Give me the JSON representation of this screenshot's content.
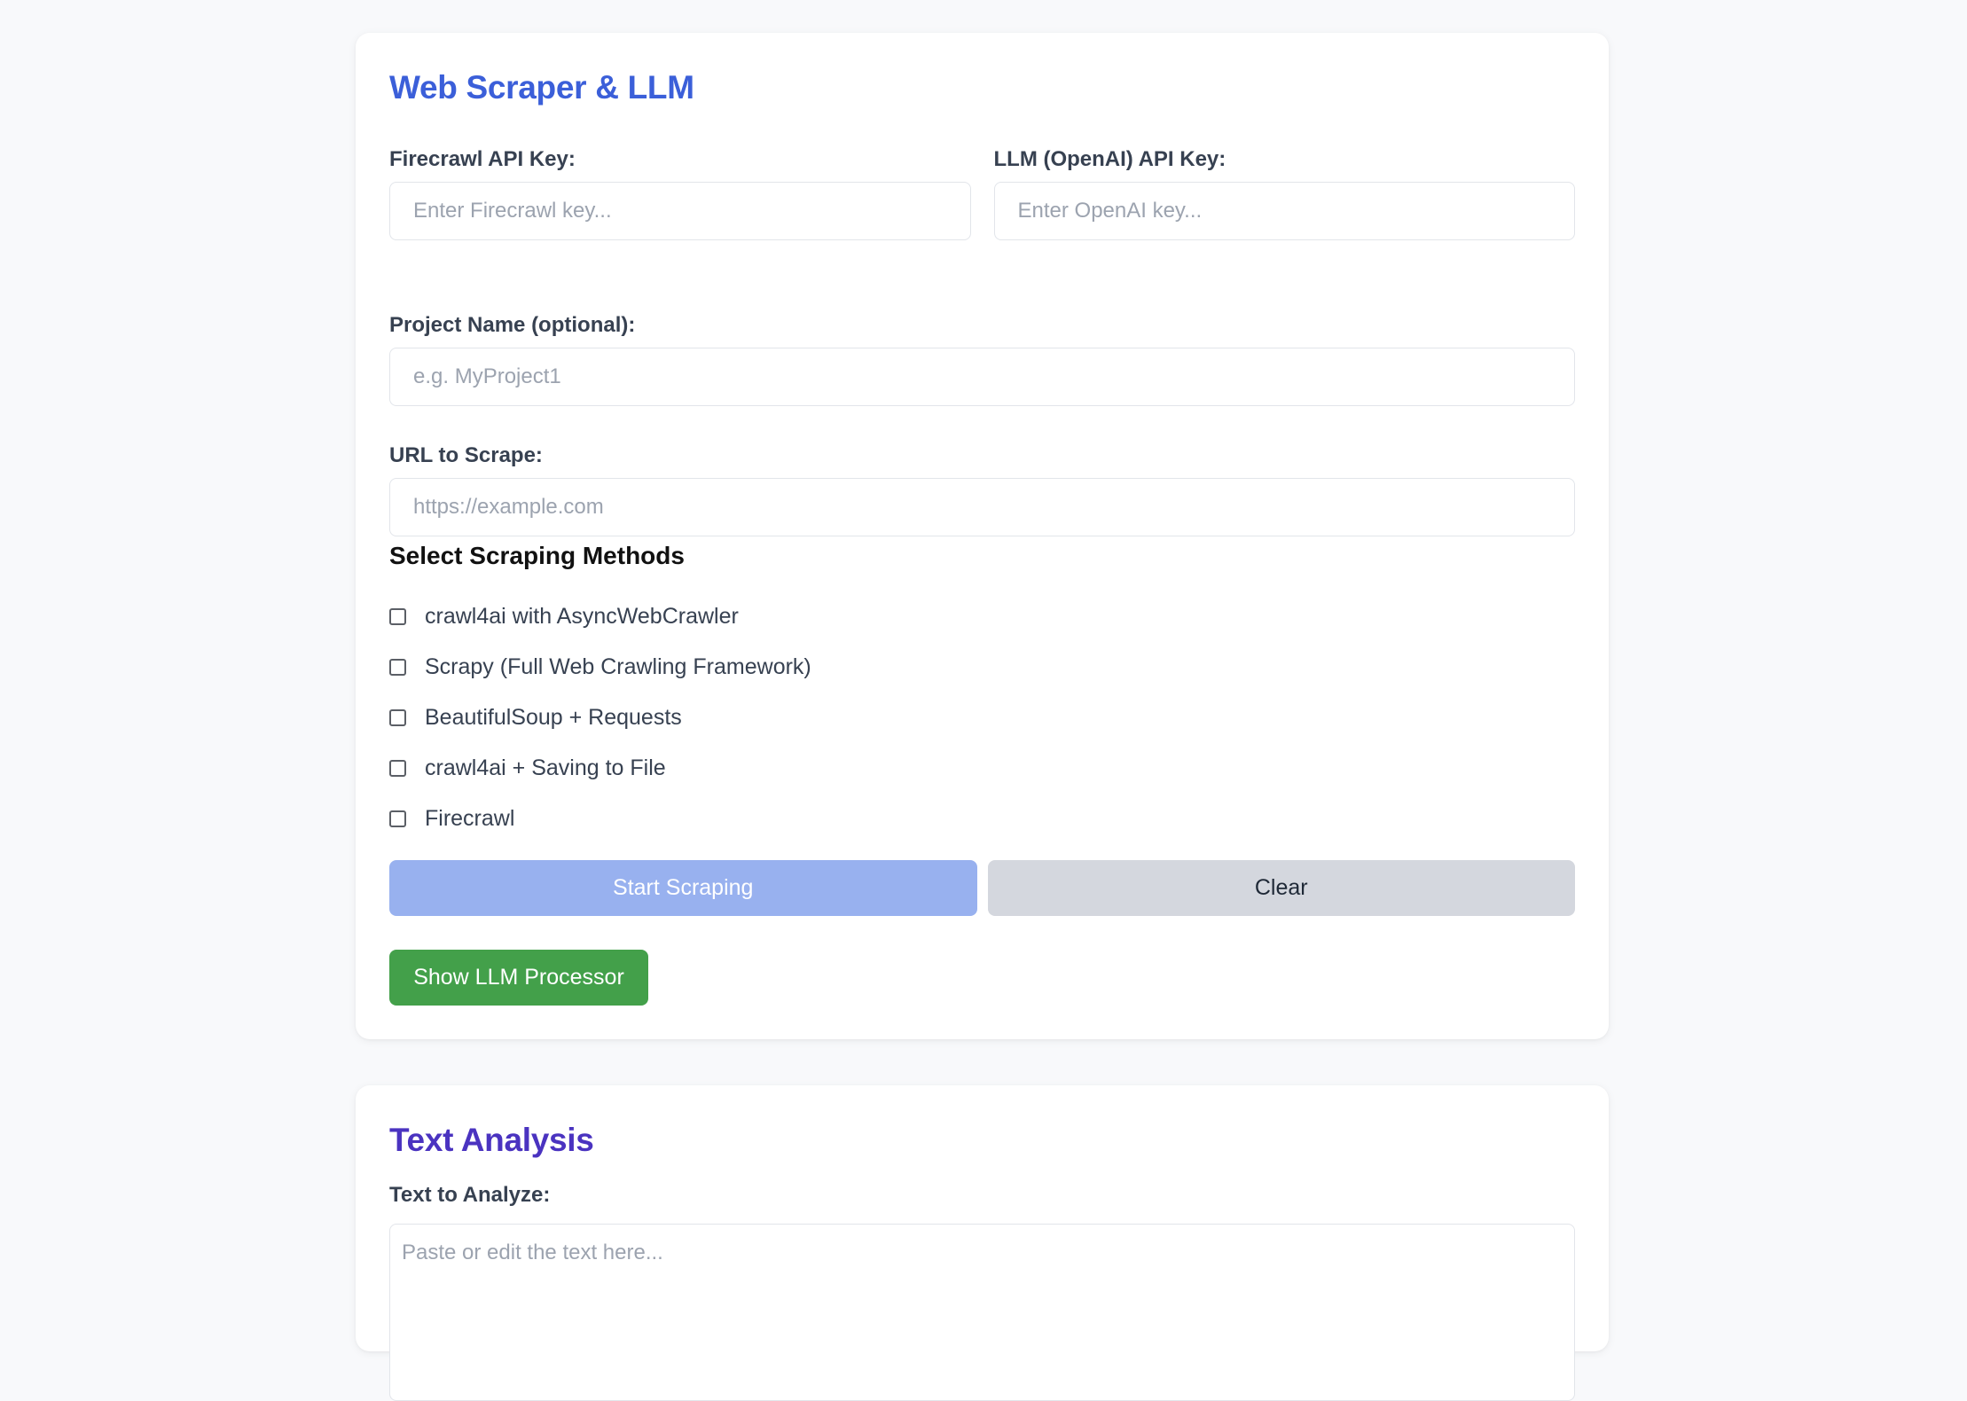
{
  "scraper": {
    "title": "Web Scraper & LLM",
    "firecrawl_label": "Firecrawl API Key:",
    "firecrawl_placeholder": "Enter Firecrawl key...",
    "llm_label": "LLM (OpenAI) API Key:",
    "llm_placeholder": "Enter OpenAI key...",
    "project_label": "Project Name (optional):",
    "project_placeholder": "e.g. MyProject1",
    "url_label": "URL to Scrape:",
    "url_placeholder": "https://example.com",
    "methods_heading": "Select Scraping Methods",
    "methods": [
      {
        "label": "crawl4ai with AsyncWebCrawler",
        "checked": false
      },
      {
        "label": "Scrapy (Full Web Crawling Framework)",
        "checked": false
      },
      {
        "label": "BeautifulSoup + Requests",
        "checked": false
      },
      {
        "label": "crawl4ai + Saving to File",
        "checked": false
      },
      {
        "label": "Firecrawl",
        "checked": false
      }
    ],
    "start_button": "Start Scraping",
    "clear_button": "Clear",
    "llm_button": "Show LLM Processor"
  },
  "analysis": {
    "title": "Text Analysis",
    "text_label": "Text to Analyze:",
    "text_placeholder": "Paste or edit the text here..."
  },
  "colors": {
    "scraper_title": "#3b5fd9",
    "analysis_title": "#4a33c0",
    "start_button_bg": "#98b1ef",
    "clear_button_bg": "#d4d7de",
    "llm_button_bg": "#43a04a",
    "page_bg": "#f8f9fb"
  }
}
